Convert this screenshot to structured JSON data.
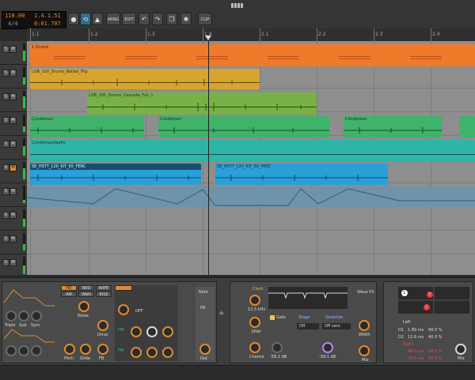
{
  "transport": {
    "tempo": "110.00",
    "position": "1.4.1.51",
    "time_signature": "4/4",
    "time": "0:01.707"
  },
  "toolbar": {
    "arrange_label": "ARNG",
    "edit_label": "EDIT",
    "clip_label": "CLIP"
  },
  "ruler": {
    "ticks": [
      "1.1",
      "1.2",
      "1.3",
      "1.4",
      "2.1",
      "2.2",
      "2.3",
      "2.4"
    ]
  },
  "clips": {
    "drums": "1 Drums",
    "ballad": "LOB_100_Drums_Ballad_Trip",
    "cascade": "LOB_105_Drums_Cascade_Full_1",
    "condor_a": "Condoroun",
    "condor_b": "Condoroun",
    "condor_c": "Condoroun",
    "condor_long": "Condoroundaafts",
    "perc_a": "SE_HSTT_120_KIT_65_PERC",
    "perc_b": "SE_HSTT_120_KIT_65_PERC"
  },
  "device_chain": {
    "synth_tabs": [
      "HD",
      "NEO",
      "WIPE",
      "AM",
      "WAH",
      "RISE"
    ],
    "synth_labels": {
      "triple": "Triple",
      "sub": "Sub",
      "sync": "Sync",
      "noise": "Noise",
      "drive": "Drive",
      "off": "OFF",
      "pitch": "Pitch",
      "glide": "Glide",
      "fb": "FB",
      "out": "Out",
      "fm": "FM",
      "fm2": "FM",
      "fm3": "FM"
    },
    "note_label": "Note",
    "pr_label": "PR",
    "clock_label": "Clock",
    "clock_value": "12.5 kHz",
    "jitter_label": "Jitter",
    "chance_label": "Chance",
    "gate_label": "Gate",
    "stage_label": "Stage",
    "stage_value": "Off",
    "quantize_label": "Quantize",
    "quantize_value": "Off zero",
    "out_db": "-58.2 dB",
    "mix_db": "-39.1 dB",
    "width_label": "Width",
    "mix_label": "Mix",
    "wave_fx_label": "Wave FX",
    "delay": {
      "left_label": "Left",
      "left_d1": "1.89 ms",
      "left_d1_pct": "68.0 %",
      "left_d2": "12.6 ms",
      "left_d2_pct": "40.0 %",
      "right_label": "Right",
      "right_d1": "48.0 ms",
      "right_d1_pct": "34.5 %",
      "right_d2": "43.5 ms",
      "right_d2_pct": "32.0 %",
      "mix_label": "Mix",
      "d1_tag": "D1",
      "d2_tag": "D2",
      "pt1": "1",
      "pt2": "2",
      "pt3": "3"
    }
  }
}
